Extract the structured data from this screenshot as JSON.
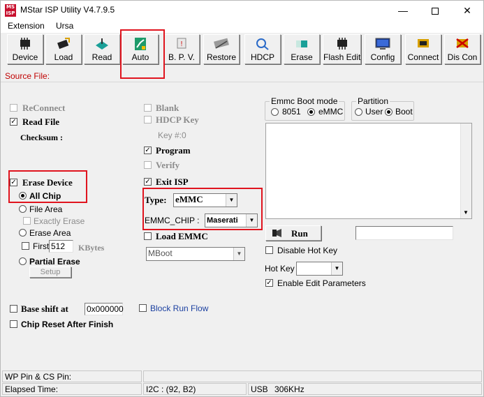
{
  "window": {
    "title": "MStar ISP Utility V4.7.9.5",
    "icon_text": "MS ISP",
    "minimize_icon": "minimize-icon",
    "maximize_icon": "maximize-icon",
    "close_icon": "close-icon"
  },
  "menu": [
    "Extension",
    "Ursa"
  ],
  "toolbar": [
    {
      "label": "Device",
      "icon": "chip-icon"
    },
    {
      "label": "Load",
      "icon": "load-chip-icon"
    },
    {
      "label": "Read",
      "icon": "read-icon"
    },
    {
      "label": "Auto",
      "icon": "auto-icon"
    },
    {
      "label": "B. P. V.",
      "icon": "bpv-icon"
    },
    {
      "label": "Restore",
      "icon": "restore-icon"
    },
    {
      "label": "HDCP",
      "icon": "hdcp-key-icon"
    },
    {
      "label": "Erase",
      "icon": "erase-icon"
    },
    {
      "label": "Flash Edit",
      "icon": "flash-edit-icon"
    },
    {
      "label": "Config",
      "icon": "config-icon"
    },
    {
      "label": "Connect",
      "icon": "connect-icon"
    },
    {
      "label": "Dis Con",
      "icon": "disconnect-icon"
    }
  ],
  "source_file_label": "Source File:",
  "left": {
    "reconnect": "ReConnect",
    "read_file": "Read File",
    "checksum": "Checksum :",
    "erase_device": "Erase Device",
    "all_chip": "All Chip",
    "file_area": "File Area",
    "exactly_erase": "Exactly Erase",
    "erase_area": "Erase Area",
    "first": "First",
    "first_value": "512",
    "kbytes": "KBytes",
    "partial_erase": "Partial Erase",
    "setup": "Setup",
    "base_shift": "Base shift at",
    "base_shift_value": "0x000000",
    "chip_reset": "Chip Reset After Finish",
    "block_run_flow": "Block Run Flow"
  },
  "middle": {
    "blank": "Blank",
    "hdcp_key": "HDCP Key",
    "key_index": "Key #:0",
    "program": "Program",
    "verify": "Verify",
    "exit_isp": "Exit ISP",
    "type_label": "Type:",
    "type_value": "eMMC",
    "emmc_chip_label": "EMMC_CHIP :",
    "emmc_chip_value": "Maserati",
    "load_emmc": "Load EMMC",
    "mboot_value": "MBoot"
  },
  "right": {
    "emmc_boot_mode": "Emmc Boot mode",
    "opt_8051": "8051",
    "opt_emmc": "eMMC",
    "partition": "Partition",
    "opt_user": "User",
    "opt_boot": "Boot",
    "run": "Run",
    "disable_hot_key": "Disable Hot Key",
    "hot_key": "Hot Key",
    "enable_edit_params": "Enable Edit Parameters"
  },
  "status": {
    "wp_pin": "WP Pin & CS Pin:",
    "elapsed": "Elapsed Time:",
    "i2c": "I2C : (92, B2)",
    "usb": "USB",
    "usb_speed": "306KHz"
  },
  "colors": {
    "highlight": "#e0141e",
    "source_file": "#c00000",
    "link_blue": "#1a3fa0"
  }
}
